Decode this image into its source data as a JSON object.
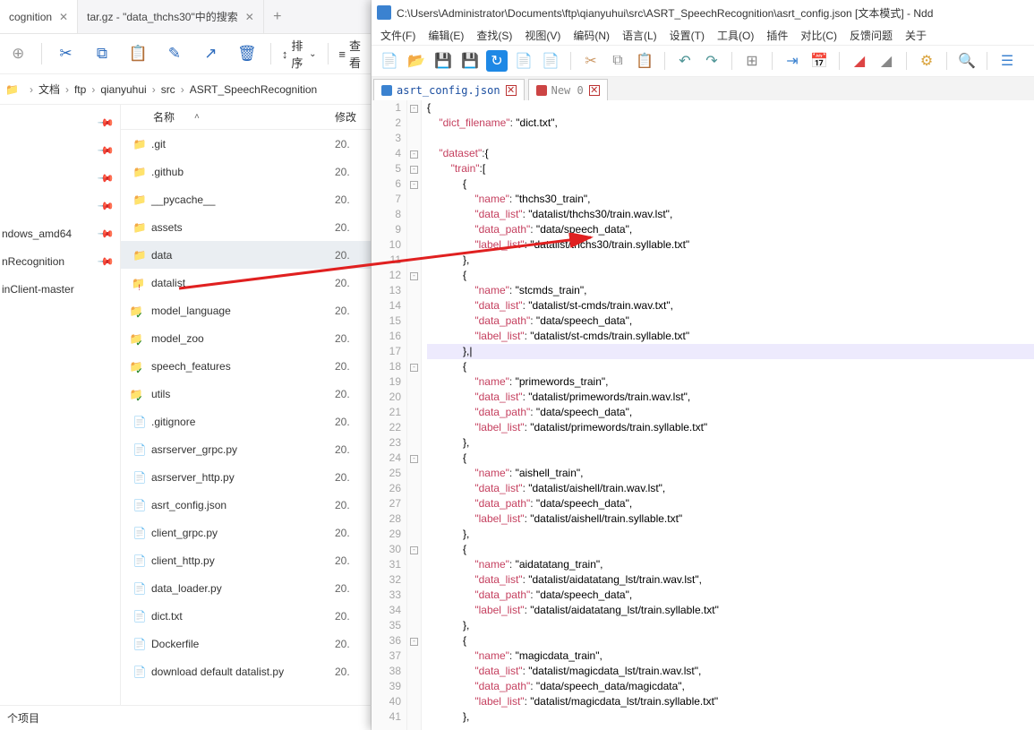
{
  "explorer": {
    "tabs": [
      {
        "label": "cognition",
        "active": true
      },
      {
        "label": "tar.gz - \"data_thchs30\"中的搜索",
        "active": false
      }
    ],
    "newtab": "+",
    "toolbar": {
      "sort": "排序",
      "view": "查看"
    },
    "breadcrumb": [
      "文档",
      "ftp",
      "qianyuhui",
      "src",
      "ASRT_SpeechRecognition"
    ],
    "columns": {
      "name": "名称",
      "mod": "修改"
    },
    "quick": [
      {
        "label": ""
      },
      {
        "label": ""
      },
      {
        "label": ""
      },
      {
        "label": ""
      },
      {
        "label": "ndows_amd64"
      },
      {
        "label": "nRecognition"
      },
      {
        "label": "inClient-master"
      }
    ],
    "files": [
      {
        "name": ".git",
        "icon": "folder",
        "mod": "20."
      },
      {
        "name": ".github",
        "icon": "folder",
        "mod": "20."
      },
      {
        "name": "__pycache__",
        "icon": "folder",
        "mod": "20."
      },
      {
        "name": "assets",
        "icon": "folder",
        "mod": "20."
      },
      {
        "name": "data",
        "icon": "folder",
        "mod": "20.",
        "selected": true
      },
      {
        "name": "datalist",
        "icon": "folder-err",
        "mod": "20."
      },
      {
        "name": "model_language",
        "icon": "folder-ok",
        "mod": "20."
      },
      {
        "name": "model_zoo",
        "icon": "folder-ok",
        "mod": "20."
      },
      {
        "name": "speech_features",
        "icon": "folder-ok",
        "mod": "20."
      },
      {
        "name": "utils",
        "icon": "folder-ok",
        "mod": "20."
      },
      {
        "name": ".gitignore",
        "icon": "git",
        "mod": "20."
      },
      {
        "name": "asrserver_grpc.py",
        "icon": "py",
        "mod": "20."
      },
      {
        "name": "asrserver_http.py",
        "icon": "py",
        "mod": "20."
      },
      {
        "name": "asrt_config.json",
        "icon": "json",
        "mod": "20."
      },
      {
        "name": "client_grpc.py",
        "icon": "py",
        "mod": "20."
      },
      {
        "name": "client_http.py",
        "icon": "py",
        "mod": "20."
      },
      {
        "name": "data_loader.py",
        "icon": "py",
        "mod": "20."
      },
      {
        "name": "dict.txt",
        "icon": "txt",
        "mod": "20."
      },
      {
        "name": "Dockerfile",
        "icon": "docker",
        "mod": "20."
      },
      {
        "name": "download default datalist.py",
        "icon": "py",
        "mod": "20."
      }
    ],
    "status": "个项目"
  },
  "editor": {
    "title": "C:\\Users\\Administrator\\Documents\\ftp\\qianyuhui\\src\\ASRT_SpeechRecognition\\asrt_config.json [文本模式] - Ndd",
    "menu": [
      "文件(F)",
      "编辑(E)",
      "查找(S)",
      "视图(V)",
      "编码(N)",
      "语言(L)",
      "设置(T)",
      "工具(O)",
      "插件",
      "对比(C)",
      "反馈问题",
      "关于"
    ],
    "tabs": [
      {
        "label": "asrt_config.json",
        "active": true
      },
      {
        "label": "New 0",
        "active": false
      }
    ],
    "lines": [
      "{",
      "    \"dict_filename\": \"dict.txt\",",
      "",
      "    \"dataset\":{",
      "        \"train\":[",
      "            {",
      "                \"name\": \"thchs30_train\",",
      "                \"data_list\": \"datalist/thchs30/train.wav.lst\",",
      "                \"data_path\": \"data/speech_data\",",
      "                \"label_list\": \"datalist/thchs30/train.syllable.txt\"",
      "            },",
      "            {",
      "                \"name\": \"stcmds_train\",",
      "                \"data_list\": \"datalist/st-cmds/train.wav.txt\",",
      "                \"data_path\": \"data/speech_data\",",
      "                \"label_list\": \"datalist/st-cmds/train.syllable.txt\"",
      "            },|",
      "            {",
      "                \"name\": \"primewords_train\",",
      "                \"data_list\": \"datalist/primewords/train.wav.lst\",",
      "                \"data_path\": \"data/speech_data\",",
      "                \"label_list\": \"datalist/primewords/train.syllable.txt\"",
      "            },",
      "            {",
      "                \"name\": \"aishell_train\",",
      "                \"data_list\": \"datalist/aishell/train.wav.lst\",",
      "                \"data_path\": \"data/speech_data\",",
      "                \"label_list\": \"datalist/aishell/train.syllable.txt\"",
      "            },",
      "            {",
      "                \"name\": \"aidatatang_train\",",
      "                \"data_list\": \"datalist/aidatatang_lst/train.wav.lst\",",
      "                \"data_path\": \"data/speech_data\",",
      "                \"label_list\": \"datalist/aidatatang_lst/train.syllable.txt\"",
      "            },",
      "            {",
      "                \"name\": \"magicdata_train\",",
      "                \"data_list\": \"datalist/magicdata_lst/train.wav.lst\",",
      "                \"data_path\": \"data/speech_data/magicdata\",",
      "                \"label_list\": \"datalist/magicdata_lst/train.syllable.txt\"",
      "            },"
    ]
  }
}
